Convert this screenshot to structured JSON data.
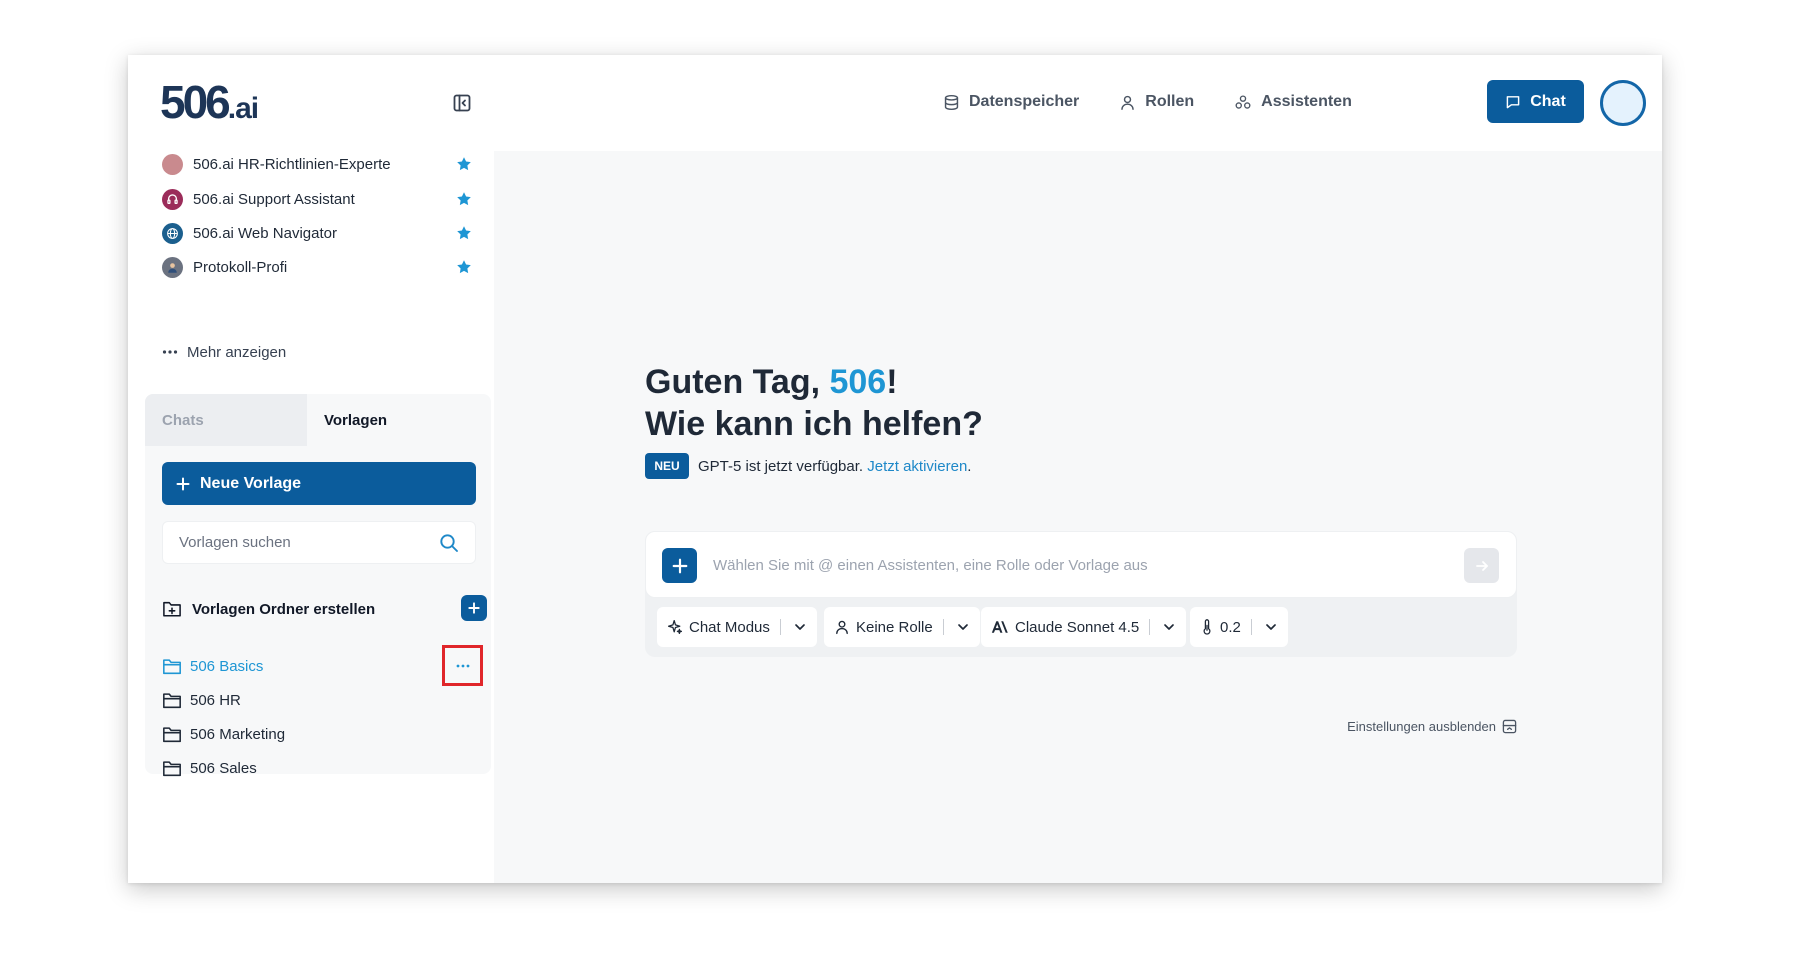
{
  "header": {
    "logo_main": "506",
    "logo_suffix": ".ai",
    "nav": [
      {
        "label": "Datenspeicher",
        "icon": "database-icon"
      },
      {
        "label": "Rollen",
        "icon": "user-icon"
      },
      {
        "label": "Assistenten",
        "icon": "assistants-icon"
      }
    ],
    "chat_button": "Chat"
  },
  "sidebar": {
    "favorites": [
      {
        "label": "506.ai HR-Richtlinien-Experte",
        "icon": "assistant-avatar-icon",
        "starred": true
      },
      {
        "label": "506.ai Support Assistant",
        "icon": "support-avatar-icon",
        "starred": true
      },
      {
        "label": "506.ai Web Navigator",
        "icon": "globe-avatar-icon",
        "starred": true
      },
      {
        "label": "Protokoll-Profi",
        "icon": "person-avatar-icon",
        "starred": true
      }
    ],
    "more_label": "Mehr anzeigen",
    "tabs": [
      {
        "label": "Chats",
        "active": false
      },
      {
        "label": "Vorlagen",
        "active": true
      }
    ],
    "new_template_button": "Neue Vorlage",
    "search_placeholder": "Vorlagen suchen",
    "create_folder_label": "Vorlagen Ordner erstellen",
    "folders": [
      {
        "label": "506 Basics",
        "active": true
      },
      {
        "label": "506 HR",
        "active": false
      },
      {
        "label": "506 Marketing",
        "active": false
      },
      {
        "label": "506 Sales",
        "active": false
      }
    ]
  },
  "main": {
    "greeting_prefix": "Guten Tag, ",
    "greeting_name": "506",
    "greeting_suffix": "!",
    "greeting_line2": "Wie kann ich helfen?",
    "badge": "NEU",
    "notice_text": "GPT-5 ist jetzt verfügbar.",
    "notice_link": "Jetzt aktivieren",
    "notice_end": ".",
    "composer_placeholder": "Wählen Sie mit @ einen Assistenten, eine Rolle oder Vorlage aus",
    "options": [
      {
        "label": "Chat Modus",
        "icon": "sparkle-icon"
      },
      {
        "label": "Keine Rolle",
        "icon": "user-icon"
      },
      {
        "label": "Claude Sonnet 4.5",
        "icon": "anthropic-icon"
      },
      {
        "label": "0.2",
        "icon": "thermometer-icon"
      }
    ],
    "hide_settings": "Einstellungen ausblenden"
  },
  "colors": {
    "primary": "#0b5c9c",
    "accent": "#1e96d4",
    "highlight_box": "#e0262a",
    "star": "#1e96d4"
  }
}
